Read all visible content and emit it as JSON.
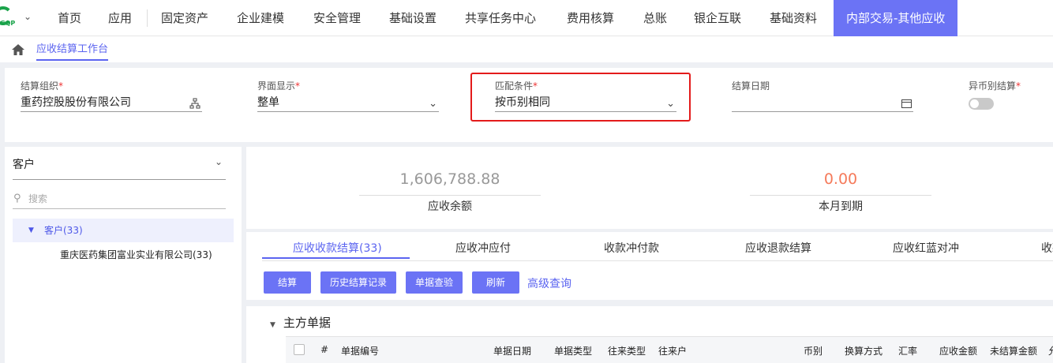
{
  "topnav": {
    "logo_text": "GQP",
    "items": [
      "首页",
      "应用",
      "固定资产",
      "企业建模",
      "安全管理",
      "基础设置",
      "共享任务中心",
      "费用核算",
      "总账",
      "银企互联",
      "基础资料"
    ],
    "active": "内部交易-其他应收",
    "accent_color": "#6b73f5"
  },
  "breadcrumb": {
    "tab": "应收结算工作台"
  },
  "filters": {
    "org_label": "结算组织",
    "org_value": "重药控股股份有限公司",
    "display_label": "界面显示",
    "display_value": "整单",
    "match_label": "匹配条件",
    "match_value": "按币别相同",
    "date_label": "结算日期",
    "date_value": "",
    "cross_currency_label": "异币别结算",
    "cross_currency_enabled": false,
    "required_mark": "*",
    "highlight_color": "#e31b1b"
  },
  "left_panel": {
    "title": "客户",
    "search_placeholder": "搜索",
    "tree_root": "客户(33)",
    "tree_child": "重庆医药集团富业实业有限公司(33)"
  },
  "summary": {
    "balance_value": "1,606,788.88",
    "balance_label": "应收余额",
    "due_value": "0.00",
    "due_label": "本月到期"
  },
  "tabs": [
    "应收收款结算(33)",
    "应收冲应付",
    "收款冲付款",
    "应收退款结算",
    "应收红蓝对冲",
    "收款"
  ],
  "buttons": {
    "settle": "结算",
    "history": "历史结算记录",
    "check": "单据查验",
    "refresh": "刷新",
    "advanced": "高级查询"
  },
  "grid": {
    "section_title": "主方单据",
    "columns": [
      "#",
      "单据编号",
      "单据日期",
      "单据类型",
      "往来类型",
      "往来户",
      "币别",
      "换算方式",
      "汇率",
      "应收金额",
      "未结算金额",
      "允"
    ]
  }
}
